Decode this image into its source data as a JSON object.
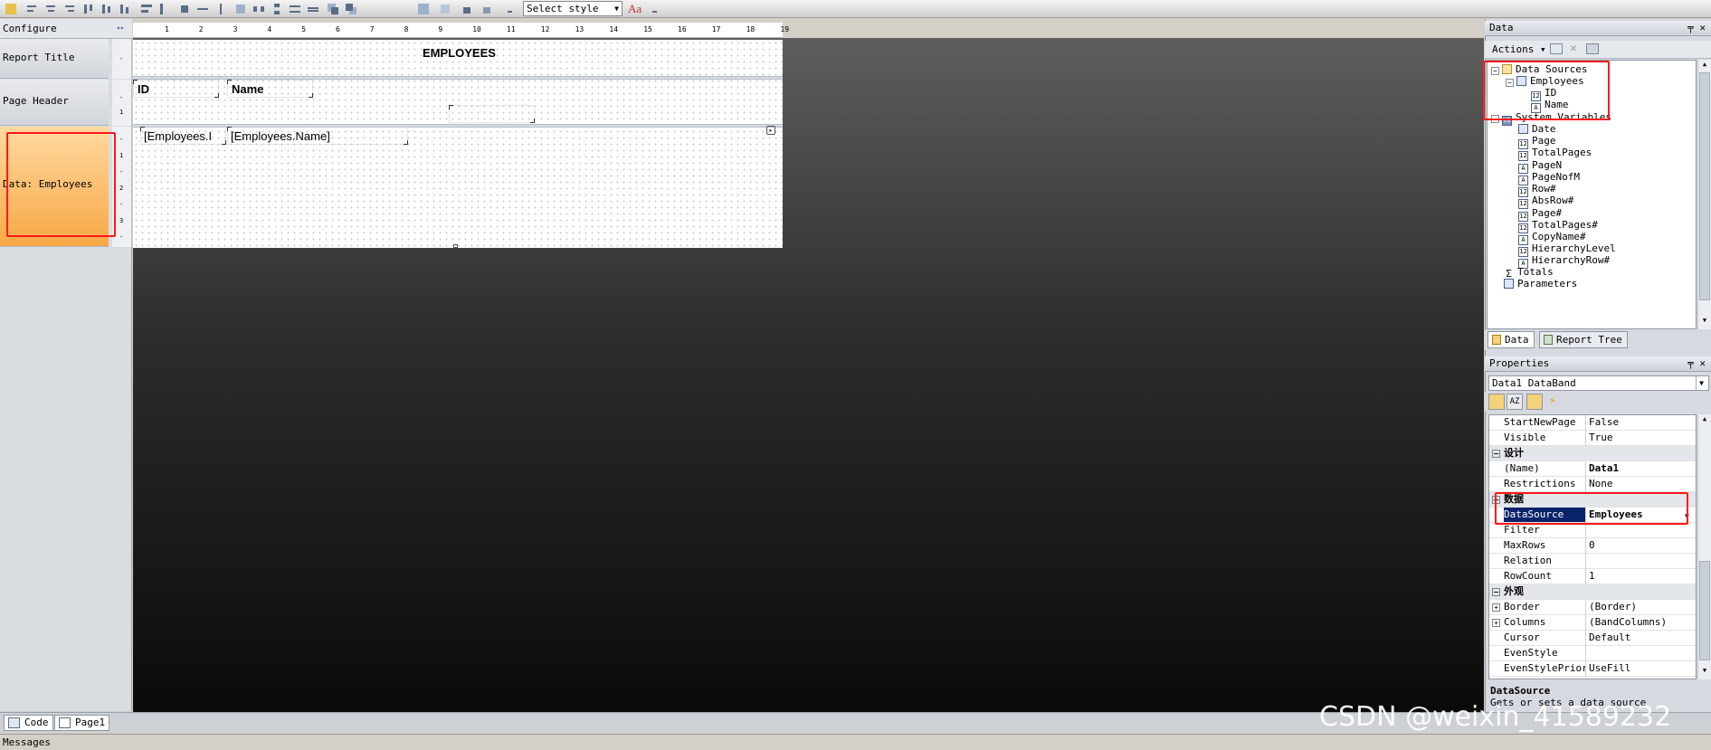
{
  "toolbar": {
    "style_select": "Select style"
  },
  "bands": {
    "configure": "Configure",
    "items": [
      "Report Title",
      "Page Header",
      "Data: Employees"
    ]
  },
  "ruler": {
    "h_ticks": [
      "1",
      "2",
      "3",
      "4",
      "5",
      "6",
      "7",
      "8",
      "9",
      "10",
      "11",
      "12",
      "13",
      "14",
      "15",
      "16",
      "17",
      "18",
      "19"
    ]
  },
  "report": {
    "title": "EMPLOYEES",
    "header_id": "ID",
    "header_name": "Name",
    "data_id": "[Employees.I",
    "data_name": "[Employees.Name]"
  },
  "bottom_tabs": {
    "code": "Code",
    "page": "Page1"
  },
  "messages_label": "Messages",
  "data_panel": {
    "title": "Data",
    "actions": "Actions",
    "tree": [
      {
        "label": "Data Sources",
        "icon": "folder-icon"
      },
      {
        "label": "Employees",
        "icon": "table-icon"
      },
      {
        "label": "ID",
        "icon": "number-field-icon",
        "badge": "12"
      },
      {
        "label": "Name",
        "icon": "text-field-icon",
        "badge": "A"
      },
      {
        "label": "System Variables",
        "icon": "variables-icon",
        "badge": "VO"
      },
      {
        "label": "Date",
        "icon": "date-icon"
      },
      {
        "label": "Page",
        "icon": "number-field-icon",
        "badge": "12"
      },
      {
        "label": "TotalPages",
        "icon": "number-field-icon",
        "badge": "12"
      },
      {
        "label": "PageN",
        "icon": "text-field-icon",
        "badge": "A"
      },
      {
        "label": "PageNofM",
        "icon": "text-field-icon",
        "badge": "A"
      },
      {
        "label": "Row#",
        "icon": "number-field-icon",
        "badge": "12"
      },
      {
        "label": "AbsRow#",
        "icon": "number-field-icon",
        "badge": "12"
      },
      {
        "label": "Page#",
        "icon": "number-field-icon",
        "badge": "12"
      },
      {
        "label": "TotalPages#",
        "icon": "number-field-icon",
        "badge": "12"
      },
      {
        "label": "CopyName#",
        "icon": "text-field-icon",
        "badge": "A"
      },
      {
        "label": "HierarchyLevel",
        "icon": "number-field-icon",
        "badge": "12"
      },
      {
        "label": "HierarchyRow#",
        "icon": "text-field-icon",
        "badge": "A"
      },
      {
        "label": "Totals",
        "icon": "sigma-icon",
        "badge": "Σ"
      },
      {
        "label": "Parameters",
        "icon": "parameters-icon"
      }
    ],
    "tabs": [
      "Data",
      "Report Tree"
    ]
  },
  "properties_panel": {
    "title": "Properties",
    "selected_object": "Data1 DataBand",
    "rows": [
      {
        "name": "StartNewPage",
        "value": "False"
      },
      {
        "name": "Visible",
        "value": "True"
      },
      {
        "name": "设计",
        "category": true
      },
      {
        "name": "(Name)",
        "value": "Data1"
      },
      {
        "name": "Restrictions",
        "value": "None"
      },
      {
        "name": "数据",
        "category": true
      },
      {
        "name": "DataSource",
        "value": "Employees",
        "selected": true
      },
      {
        "name": "Filter",
        "value": ""
      },
      {
        "name": "MaxRows",
        "value": "0"
      },
      {
        "name": "Relation",
        "value": ""
      },
      {
        "name": "RowCount",
        "value": "1"
      },
      {
        "name": "外观",
        "category": true
      },
      {
        "name": "Border",
        "value": "(Border)",
        "expandable": true
      },
      {
        "name": "Columns",
        "value": "(BandColumns)",
        "expandable": true
      },
      {
        "name": "Cursor",
        "value": "Default"
      },
      {
        "name": "EvenStyle",
        "value": ""
      },
      {
        "name": "EvenStylePriori",
        "value": "UseFill"
      }
    ],
    "desc_title": "DataSource",
    "desc_text": "Gets or sets a data source"
  },
  "watermark": "CSDN @weixin_41589232",
  "colors": {
    "highlight_red": "#ff1a1a",
    "data_band": "#f7a845",
    "selection": "#0a246a"
  }
}
